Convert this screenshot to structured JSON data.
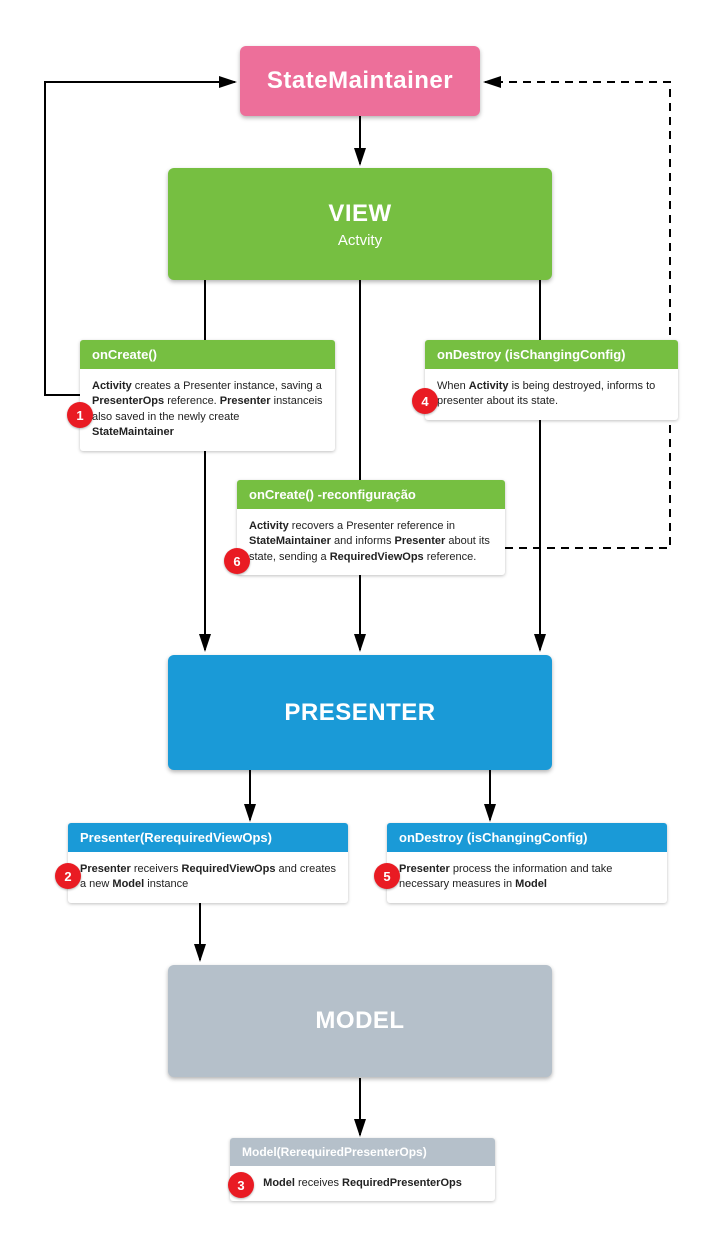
{
  "colors": {
    "pink": "#ed6f9a",
    "green": "#76bf41",
    "blue": "#1a9ad7",
    "grey": "#b5c0ca",
    "red": "#e91b23"
  },
  "blocks": {
    "stateMaintainer": {
      "title": "StateMaintainer"
    },
    "view": {
      "title": "VIEW",
      "subtitle": "Actvity"
    },
    "presenter": {
      "title": "PRESENTER"
    },
    "model": {
      "title": "MODEL"
    }
  },
  "cards": {
    "onCreate": {
      "header": "onCreate()",
      "body": "<b>Activity</b> creates a Presenter instance, saving a <b>PresenterOps</b> reference. <b>Presenter</b> instanceis also saved in the newly create <b>StateMaintainer</b>",
      "badge": "1"
    },
    "onDestroyView": {
      "header": "onDestroy (isChangingConfig)",
      "body": "When <b>Activity</b> is being destroyed, informs to presenter about its state.",
      "badge": "4"
    },
    "onCreateReconfig": {
      "header": "onCreate() -reconfiguração",
      "body": "<b>Activity</b> recovers a Presenter reference in <b>StateMaintainer</b> and informs <b>Presenter</b> about its state, sending a <b>RequiredViewOps</b> reference.",
      "badge": "6"
    },
    "presenterCtor": {
      "header": "Presenter(RerequiredViewOps)",
      "body": "<b>Presenter</b> receivers <b>RequiredViewOps</b> and creates a new <b>Model</b> instance",
      "badge": "2"
    },
    "onDestroyPresenter": {
      "header": "onDestroy (isChangingConfig)",
      "body": "<b>Presenter</b> process the information and take necessary measures in <b>Model</b>",
      "badge": "5"
    },
    "modelCtor": {
      "header": "Model(RerequiredPresenterOps)",
      "body": "<b>Model</b> receives <b>RequiredPresenterOps</b>",
      "badge": "3"
    }
  }
}
